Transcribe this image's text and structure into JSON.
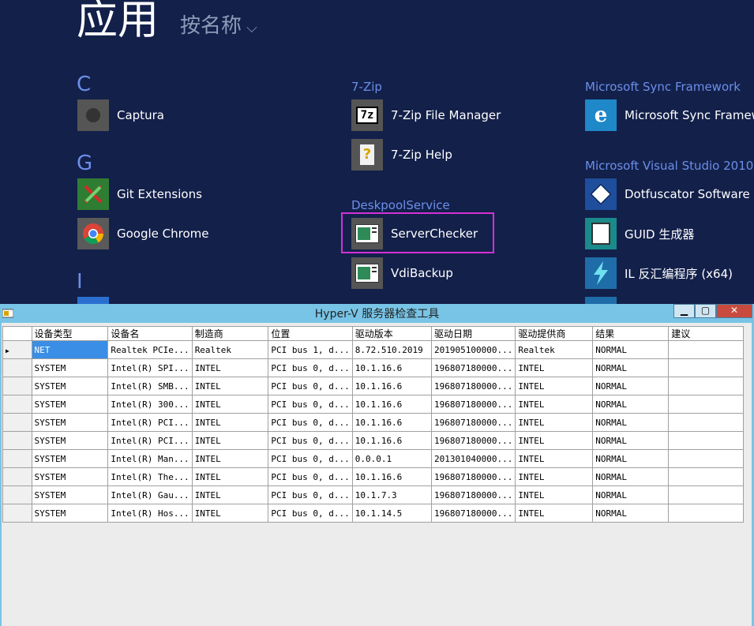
{
  "start": {
    "title": "应用",
    "sort_label": "按名称",
    "chevron": "⌵",
    "letters": [
      "C",
      "G",
      "I"
    ],
    "groups": [
      "7-Zip",
      "DeskpoolService",
      "Microsoft Sync Framework",
      "Microsoft Visual Studio 2010"
    ],
    "apps": [
      {
        "label": "Captura"
      },
      {
        "label": "Git Extensions"
      },
      {
        "label": "Google Chrome"
      },
      {
        "label": "7-Zip File Manager"
      },
      {
        "label": "7-Zip Help"
      },
      {
        "label": "ServerChecker"
      },
      {
        "label": "VdiBackup"
      },
      {
        "label": "Microsoft Sync Framew"
      },
      {
        "label": "Dotfuscator Software S"
      },
      {
        "label": "GUID 生成器"
      },
      {
        "label": "IL 反汇编程序 (x64)"
      }
    ]
  },
  "window": {
    "title": "Hyper-V 服务器检查工具",
    "minimize": "▁",
    "maximize": "▢",
    "close": "✕",
    "columns": [
      "设备类型",
      "设备名",
      "制造商",
      "位置",
      "驱动版本",
      "驱动日期",
      "驱动提供商",
      "结果",
      "建议"
    ],
    "rows": [
      [
        "NET",
        "Realtek PCIe...",
        "Realtek",
        "PCI bus 1, d...",
        "8.72.510.2019",
        "201905100000...",
        "Realtek",
        "NORMAL",
        ""
      ],
      [
        "SYSTEM",
        "Intel(R) SPI...",
        "INTEL",
        "PCI bus 0, d...",
        "10.1.16.6",
        "196807180000...",
        "INTEL",
        "NORMAL",
        ""
      ],
      [
        "SYSTEM",
        "Intel(R) SMB...",
        "INTEL",
        "PCI bus 0, d...",
        "10.1.16.6",
        "196807180000...",
        "INTEL",
        "NORMAL",
        ""
      ],
      [
        "SYSTEM",
        "Intel(R) 300...",
        "INTEL",
        "PCI bus 0, d...",
        "10.1.16.6",
        "196807180000...",
        "INTEL",
        "NORMAL",
        ""
      ],
      [
        "SYSTEM",
        "Intel(R) PCI...",
        "INTEL",
        "PCI bus 0, d...",
        "10.1.16.6",
        "196807180000...",
        "INTEL",
        "NORMAL",
        ""
      ],
      [
        "SYSTEM",
        "Intel(R) PCI...",
        "INTEL",
        "PCI bus 0, d...",
        "10.1.16.6",
        "196807180000...",
        "INTEL",
        "NORMAL",
        ""
      ],
      [
        "SYSTEM",
        "Intel(R) Man...",
        "INTEL",
        "PCI bus 0, d...",
        "0.0.0.1",
        "201301040000...",
        "INTEL",
        "NORMAL",
        ""
      ],
      [
        "SYSTEM",
        "Intel(R) The...",
        "INTEL",
        "PCI bus 0, d...",
        "10.1.16.6",
        "196807180000...",
        "INTEL",
        "NORMAL",
        ""
      ],
      [
        "SYSTEM",
        "Intel(R) Gau...",
        "INTEL",
        "PCI bus 0, d...",
        "10.1.7.3",
        "196807180000...",
        "INTEL",
        "NORMAL",
        ""
      ],
      [
        "SYSTEM",
        "Intel(R) Hos...",
        "INTEL",
        "PCI bus 0, d...",
        "10.1.14.5",
        "196807180000...",
        "INTEL",
        "NORMAL",
        ""
      ]
    ],
    "row_indicator": "▶"
  }
}
